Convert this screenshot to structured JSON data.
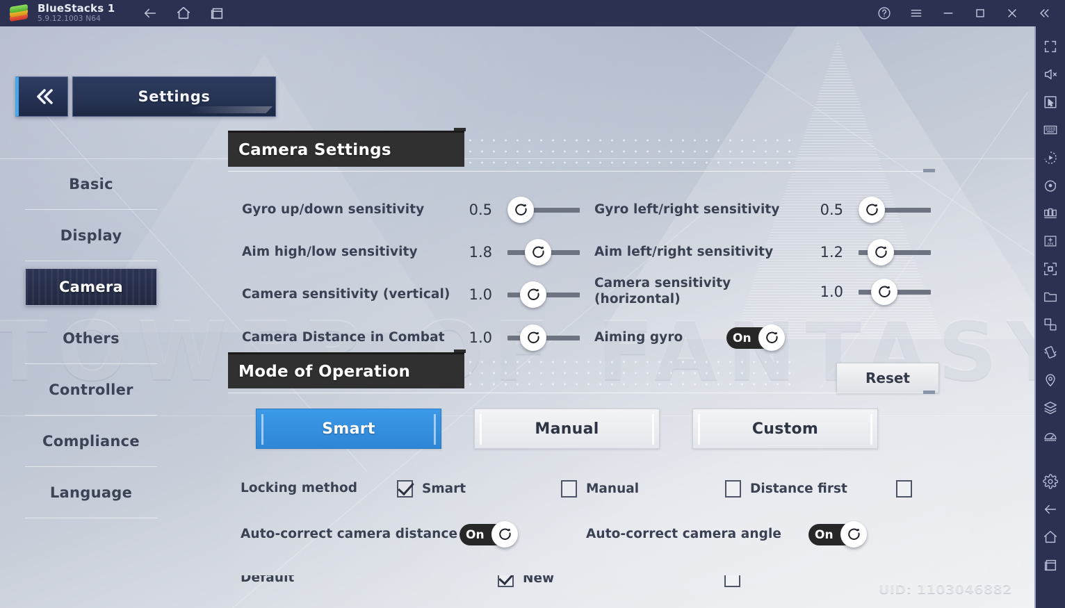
{
  "titlebar": {
    "app_name": "BlueStacks 1",
    "version": "5.9.12.1003  N64",
    "nav_icons": [
      "back-icon",
      "home-icon",
      "recents-icon"
    ],
    "window_icons": [
      "help-icon",
      "menu-icon",
      "minimize-icon",
      "maximize-icon",
      "close-icon",
      "collapse-icon"
    ]
  },
  "right_toolbar": {
    "icons": [
      "fullscreen-icon",
      "mute-icon",
      "cursor-icon",
      "keyboard-icon",
      "macro-play-icon",
      "record-icon",
      "multi-instance-icon",
      "install-apk-icon",
      "screenshot-icon",
      "media-folder-icon",
      "rotate-icon",
      "shake-icon",
      "location-icon",
      "layers-icon",
      "performance-icon",
      "settings-gear-icon",
      "android-back-icon",
      "android-home-icon",
      "android-recents-icon"
    ]
  },
  "game": {
    "back_button": "back-chevron-icon",
    "header_title": "Settings",
    "watermark": "TOWER OF FANTASY",
    "uid": "UID: 1103046882",
    "nav": [
      {
        "label": "Basic",
        "active": false
      },
      {
        "label": "Display",
        "active": false
      },
      {
        "label": "Camera",
        "active": true
      },
      {
        "label": "Others",
        "active": false
      },
      {
        "label": "Controller",
        "active": false
      },
      {
        "label": "Compliance",
        "active": false
      },
      {
        "label": "Language",
        "active": false
      }
    ],
    "camera_section": {
      "title": "Camera Settings",
      "left_rows": [
        {
          "label": "Gyro up/down sensitivity",
          "value": "0.5",
          "fill": 0.0
        },
        {
          "label": "Aim high/low sensitivity",
          "value": "1.8",
          "fill": 0.37
        },
        {
          "label": "Camera sensitivity (vertical)",
          "value": "1.0",
          "fill": 0.27
        },
        {
          "label": "Camera Distance in Combat",
          "value": "1.0",
          "fill": 0.27
        }
      ],
      "right_rows": [
        {
          "label": "Gyro left/right sensitivity",
          "value": "0.5",
          "fill": 0.0
        },
        {
          "label": "Aim left/right sensitivity",
          "value": "1.2",
          "fill": 0.2
        },
        {
          "label": "Camera sensitivity (horizontal)",
          "value": "1.0",
          "fill": 0.27
        }
      ],
      "aiming_gyro": {
        "label": "Aiming gyro",
        "state": "On"
      },
      "reset_label": "Reset"
    },
    "mode_section": {
      "title": "Mode of Operation",
      "modes": [
        {
          "label": "Smart",
          "active": true
        },
        {
          "label": "Manual",
          "active": false
        },
        {
          "label": "Custom",
          "active": false
        }
      ],
      "locking_method": {
        "label": "Locking method",
        "options": [
          {
            "label": "Smart",
            "checked": true
          },
          {
            "label": "Manual",
            "checked": false
          },
          {
            "label": "Distance first",
            "checked": false
          },
          {
            "label": "",
            "checked": false
          }
        ]
      },
      "auto_correct": [
        {
          "label": "Auto-correct camera distance",
          "state": "On"
        },
        {
          "label": "Auto-correct camera angle",
          "state": "On"
        }
      ],
      "cut_row": [
        {
          "label": "Default",
          "checked": true
        },
        {
          "label": "New",
          "checked": false
        }
      ]
    }
  }
}
